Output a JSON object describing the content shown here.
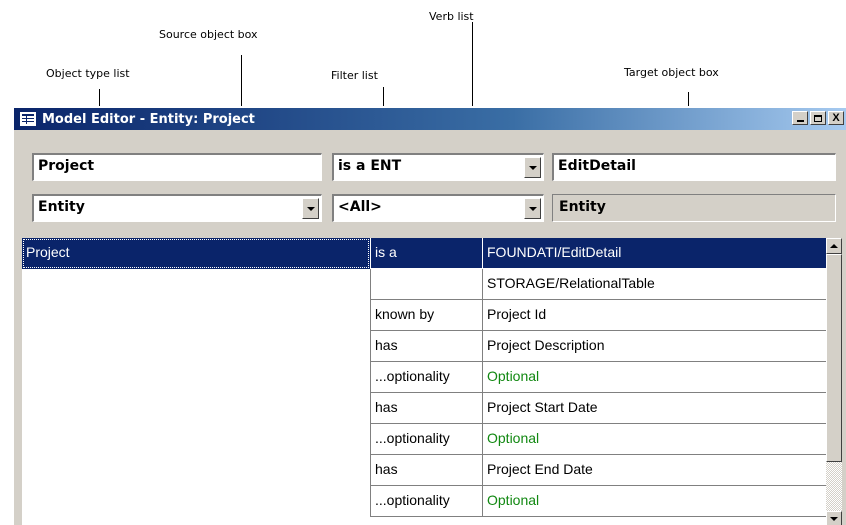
{
  "annotations": {
    "verb_list": "Verb list",
    "source_object_box": "Source object box",
    "object_type_list": "Object type list",
    "filter_list": "Filter list",
    "target_object_box": "Target object box"
  },
  "window": {
    "title": "Model Editor - Entity: Project",
    "min_label": "_",
    "max_label": "",
    "close_label": "X"
  },
  "editor": {
    "source_object": "Project",
    "verb": "is a ENT",
    "target_object": "EditDetail",
    "object_type": "Entity",
    "filter": "<All>",
    "target_type": "Entity"
  },
  "grid": {
    "rows": [
      {
        "subject": "Project",
        "verb": "is a",
        "object": "FOUNDATI/EditDetail",
        "selected": true
      },
      {
        "subject": "",
        "verb": "",
        "object": "STORAGE/RelationalTable"
      },
      {
        "subject": "",
        "verb": "known by",
        "object": "Project Id"
      },
      {
        "subject": "",
        "verb": "has",
        "object": "Project Description"
      },
      {
        "subject": "",
        "verb": "...optionality",
        "object": "Optional",
        "green": true
      },
      {
        "subject": "",
        "verb": "has",
        "object": "Project Start Date"
      },
      {
        "subject": "",
        "verb": "...optionality",
        "object": "Optional",
        "green": true
      },
      {
        "subject": "",
        "verb": "has",
        "object": "Project End Date"
      },
      {
        "subject": "",
        "verb": "...optionality",
        "object": "Optional",
        "green": true
      }
    ]
  },
  "colors": {
    "title_bar": "#0a246a",
    "selection": "#0a246a",
    "optional_text": "#118811",
    "window_face": "#d4d0c8"
  }
}
